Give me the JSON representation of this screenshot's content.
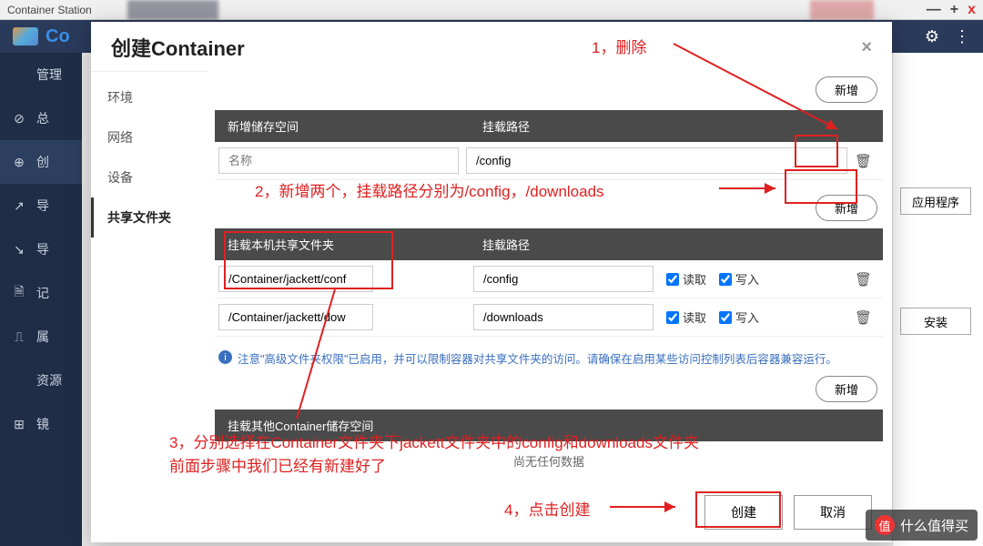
{
  "window": {
    "title": "Container Station",
    "min": "—",
    "max": "+",
    "close": "x"
  },
  "bg": {
    "app_abbrev": "Co",
    "gear": "⚙",
    "menu": "⋮"
  },
  "sidebar": {
    "items": [
      {
        "icon": "",
        "label": "管理"
      },
      {
        "icon": "⊘",
        "label": "总"
      },
      {
        "icon": "⊕",
        "label": "创"
      },
      {
        "icon": "↗",
        "label": "导"
      },
      {
        "icon": "↘",
        "label": "导"
      },
      {
        "icon": "🗎",
        "label": "记"
      },
      {
        "icon": "⎍",
        "label": "属"
      },
      {
        "icon": "",
        "label": "资源"
      },
      {
        "icon": "⊞",
        "label": "镜"
      }
    ]
  },
  "rightpane": {
    "btn1": "应用程序",
    "btn2": "安装"
  },
  "modal": {
    "title": "创建Container",
    "tabs": [
      "环境",
      "网络",
      "设备",
      "共享文件夹"
    ],
    "section1": {
      "add": "新增",
      "col_a": "新增储存空间",
      "col_b": "挂载路径",
      "rows": [
        {
          "name_ph": "名称",
          "path": "/config"
        }
      ]
    },
    "section2": {
      "add": "新增",
      "col_a": "挂载本机共享文件夹",
      "col_b": "挂载路径",
      "read": "读取",
      "write": "写入",
      "rows": [
        {
          "folder": "/Container/jackett/conf",
          "path": "/config"
        },
        {
          "folder": "/Container/jackett/dow",
          "path": "/downloads"
        }
      ],
      "note": "注意\"高级文件夹权限\"已启用，并可以限制容器对共享文件夹的访问。请确保在启用某些访问控制列表后容器兼容运行。"
    },
    "section3": {
      "add": "新增",
      "header": "挂载其他Container储存空间",
      "nodata": "尚无任何数据"
    },
    "footer": {
      "create": "创建",
      "cancel": "取消"
    }
  },
  "annotations": {
    "a1": "1，删除",
    "a2": "2，新增两个，挂载路径分别为/config，/downloads",
    "a3": "3，分别选择在Container文件夹下jackett文件夹中的config和downloads文件夹\n前面步骤中我们已经有新建好了",
    "a4": "4，点击创建"
  },
  "watermark": {
    "char": "值",
    "text": "什么值得买"
  }
}
